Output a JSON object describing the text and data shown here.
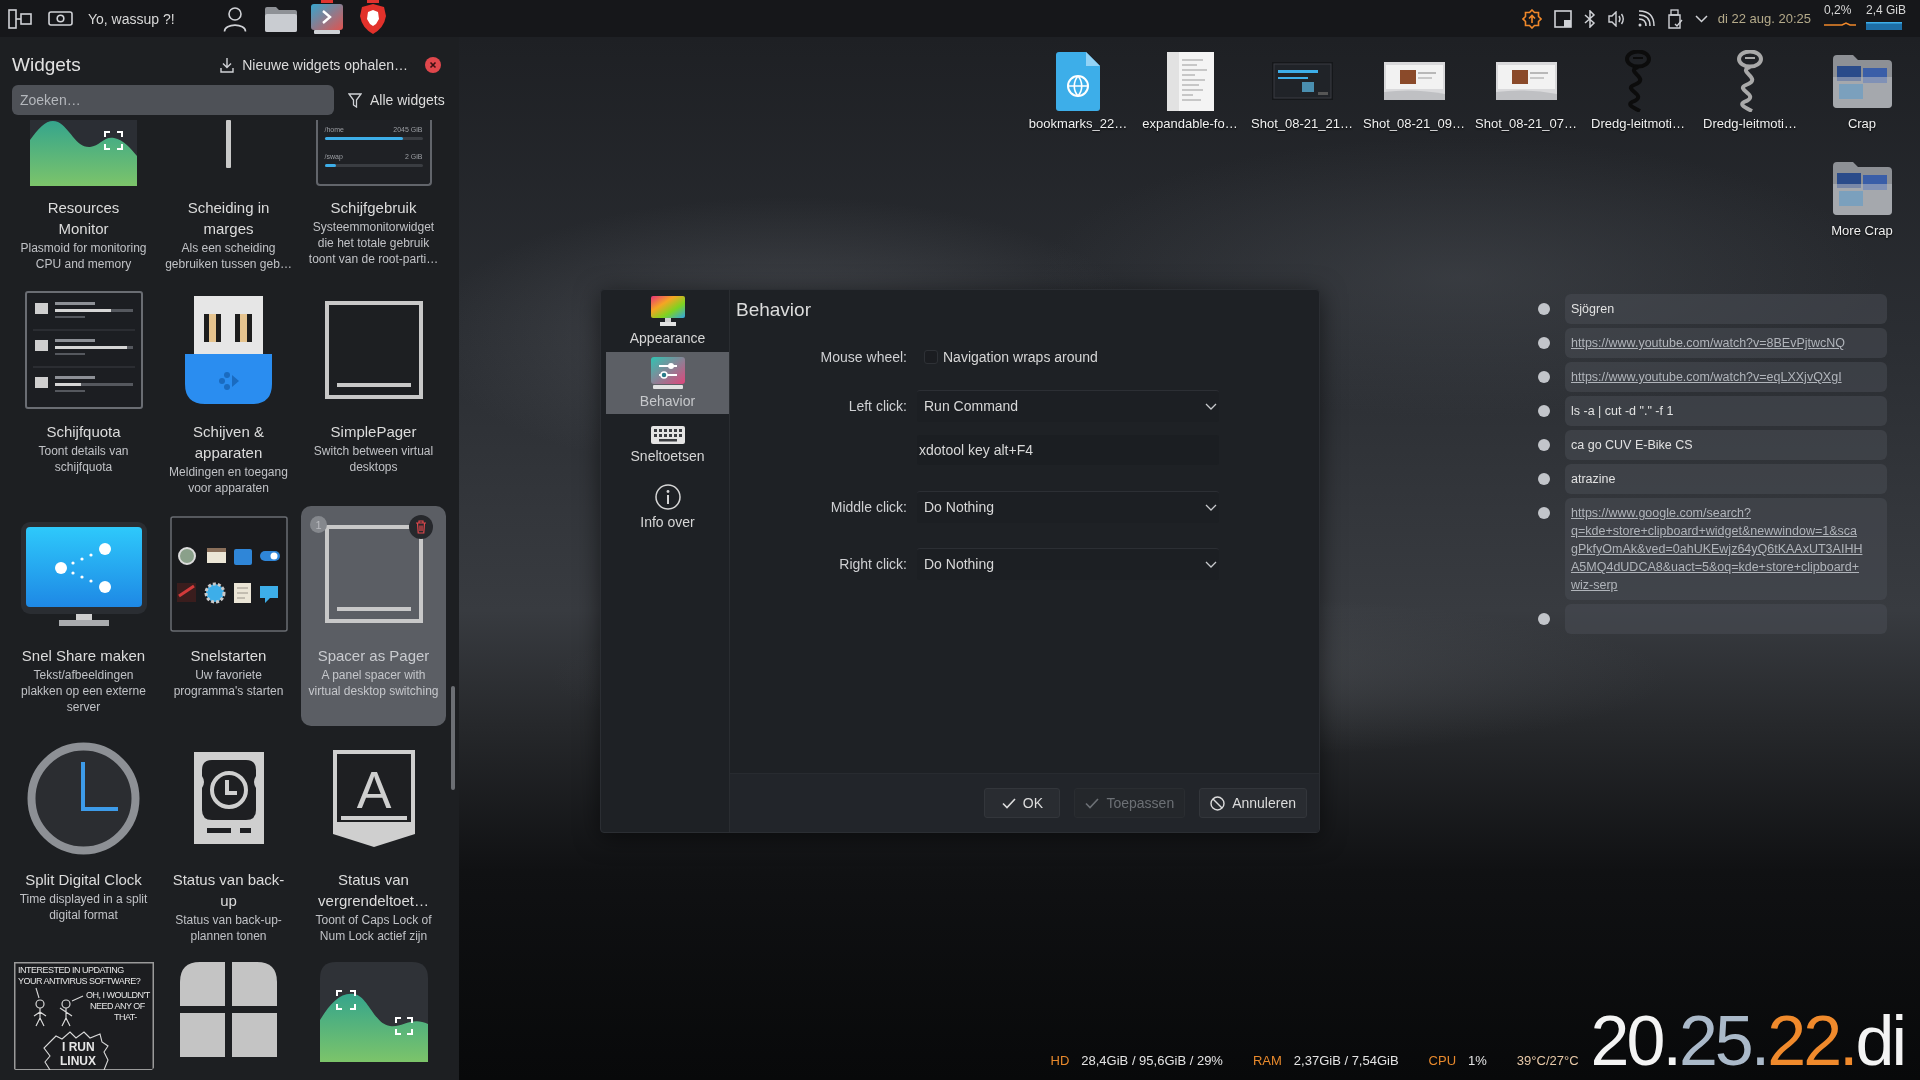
{
  "panel": {
    "greeting": "Yo, wassup ?!",
    "tasks": [
      {
        "kind": "user",
        "running": false
      },
      {
        "kind": "folder",
        "running": false
      },
      {
        "kind": "monitor-app",
        "running": true
      },
      {
        "kind": "shield",
        "running": true
      }
    ],
    "clock": "di 22 aug. 20:25",
    "cpu": "0,2%",
    "memory": "2,4 GiB"
  },
  "widgets_panel": {
    "title": "Widgets",
    "get_new": "Nieuwe widgets ophalen…",
    "search": {
      "placeholder": "Zoeken…"
    },
    "filter": "Alle widgets",
    "widgets": [
      {
        "kind": "resources",
        "title": "Resources Monitor",
        "description": "Plasmoid for monitoring CPU and memory",
        "selected": false
      },
      {
        "kind": "separator",
        "title": "Scheiding in marges",
        "description": "Als een scheiding gebruiken tussen geb…",
        "selected": false
      },
      {
        "kind": "disk-usage",
        "title": "Schijfgebruik",
        "description": "Systeemmonitorwidget die het totale gebruik toont van de root-parti…",
        "selected": false,
        "preview": [
          {
            "label": "/home",
            "value": "2045 GiB",
            "level": 0.8
          },
          {
            "label": "/swap",
            "value": "2 GiB",
            "level": 0.12
          }
        ]
      },
      {
        "kind": "disk-quota",
        "title": "Schijfquota",
        "description": "Toont details van schijfquota",
        "selected": false
      },
      {
        "kind": "devices",
        "title": "Schijven & apparaten",
        "description": "Meldingen en toegang voor apparaten",
        "selected": false
      },
      {
        "kind": "pager",
        "title": "SimplePager",
        "description": "Switch between virtual desktops",
        "selected": false
      },
      {
        "kind": "share",
        "title": "Snel Share maken",
        "description": "Tekst/afbeeldingen plakken op een externe server",
        "selected": false
      },
      {
        "kind": "quicklaunch",
        "title": "Snelstarten",
        "description": "Uw favoriete programma's starten",
        "selected": false
      },
      {
        "kind": "pager",
        "title": "Spacer as Pager",
        "description": "A panel spacer with virtual desktop switching",
        "selected": true,
        "badge": "1"
      },
      {
        "kind": "clock",
        "title": "Split Digital Clock",
        "description": "Time displayed in a split digital format",
        "selected": false
      },
      {
        "kind": "backup",
        "title": "Status van back-up",
        "description": "Status van back-up-plannen tonen",
        "selected": false
      },
      {
        "kind": "lock-keys",
        "title": "Status van vergrendeltoet…",
        "description": "Toont of Caps Lock of Num Lock actief zijn",
        "selected": false,
        "glyph": "A"
      },
      {
        "kind": "comic",
        "selected": false,
        "comic_text": [
          "INTERESTED IN UPDATING",
          "YOUR ANTIVIRUS SOFTWARE?",
          "OH, I WOULDN'T",
          "NEED ANY OF",
          "THAT-",
          "I RUN",
          "LINUX"
        ]
      },
      {
        "kind": "tiles",
        "selected": false
      },
      {
        "kind": "resources-tile",
        "selected": false
      }
    ]
  },
  "desktop_icons": [
    {
      "kind": "document-globe",
      "label": "bookmarks_22…"
    },
    {
      "kind": "document",
      "label": "expandable-fo…"
    },
    {
      "kind": "screenshot-dark",
      "label": "Shot_08-21_21…"
    },
    {
      "kind": "screenshot-light",
      "label": "Shot_08-21_09…"
    },
    {
      "kind": "screenshot-light",
      "label": "Shot_08-21_07…"
    },
    {
      "kind": "figure-dark",
      "label": "Dredg-leitmoti…"
    },
    {
      "kind": "figure-light",
      "label": "Dredg-leitmoti…"
    },
    {
      "kind": "folder-images",
      "label": "Crap"
    },
    {
      "kind": "folder-images",
      "label": "More Crap"
    }
  ],
  "dialog": {
    "pages": [
      {
        "kind": "appearance",
        "label": "Appearance",
        "selected": false
      },
      {
        "kind": "behavior",
        "label": "Behavior",
        "selected": true
      },
      {
        "kind": "shortcuts",
        "label": "Sneltoetsen",
        "selected": false
      },
      {
        "kind": "about",
        "label": "Info over",
        "selected": false
      }
    ],
    "title": "Behavior",
    "rows": [
      {
        "kind": "checkbox",
        "label": "Mouse wheel:",
        "text": "Navigation wraps around",
        "checked": false
      },
      {
        "kind": "combo",
        "label": "Left click:",
        "value": "Run Command"
      },
      {
        "kind": "text",
        "value": "xdotool key alt+F4"
      },
      {
        "kind": "combo",
        "label": "Middle click:",
        "value": "Do Nothing"
      },
      {
        "kind": "combo",
        "label": "Right click:",
        "value": "Do Nothing"
      }
    ],
    "buttons": [
      {
        "kind": "ok",
        "label": "OK",
        "disabled": false
      },
      {
        "kind": "apply",
        "label": "Toepassen",
        "disabled": true
      },
      {
        "kind": "cancel",
        "label": "Annuleren",
        "disabled": false
      }
    ]
  },
  "clipboard": {
    "items": [
      {
        "kind": "text",
        "text": "Sjögren"
      },
      {
        "kind": "link",
        "lines": [
          "https://www.youtube.com/watch?v=8BEvPjtwcNQ"
        ]
      },
      {
        "kind": "link",
        "lines": [
          "https://www.youtube.com/watch?v=eqLXXjvQXgI"
        ]
      },
      {
        "kind": "text",
        "text": "ls -a | cut -d \".\" -f 1"
      },
      {
        "kind": "text",
        "text": "ca go CUV E-Bike CS"
      },
      {
        "kind": "text",
        "text": "atrazine"
      },
      {
        "kind": "link",
        "lines": [
          "https://www.google.com/search?",
          "q=kde+store+clipboard+widget&newwindow=1&sca",
          "gPkfyOmAk&ved=0ahUKEwjz64yQ6tKAAxUT3AIHH",
          "A5MQ4dUDCA8&uact=5&oq=kde+store+clipboard+",
          "wiz-serp"
        ]
      },
      {
        "kind": "empty"
      }
    ]
  },
  "system_monitor": {
    "items": [
      {
        "label": "HD",
        "value": "28,4GiB / 95,6GiB / 29%"
      },
      {
        "label": "RAM",
        "value": "2,37GiB / 7,54GiB"
      },
      {
        "label": "CPU",
        "value": "1%"
      }
    ],
    "temperature": "39°C/27°C"
  },
  "clock": {
    "parts": [
      {
        "text": "20.",
        "color": "#f4f4f4"
      },
      {
        "text": "25.",
        "color": "#aab9c9"
      },
      {
        "text": "22.",
        "color": "#f08a2c"
      },
      {
        "text": "di",
        "color": "#f4f4f4"
      }
    ]
  }
}
